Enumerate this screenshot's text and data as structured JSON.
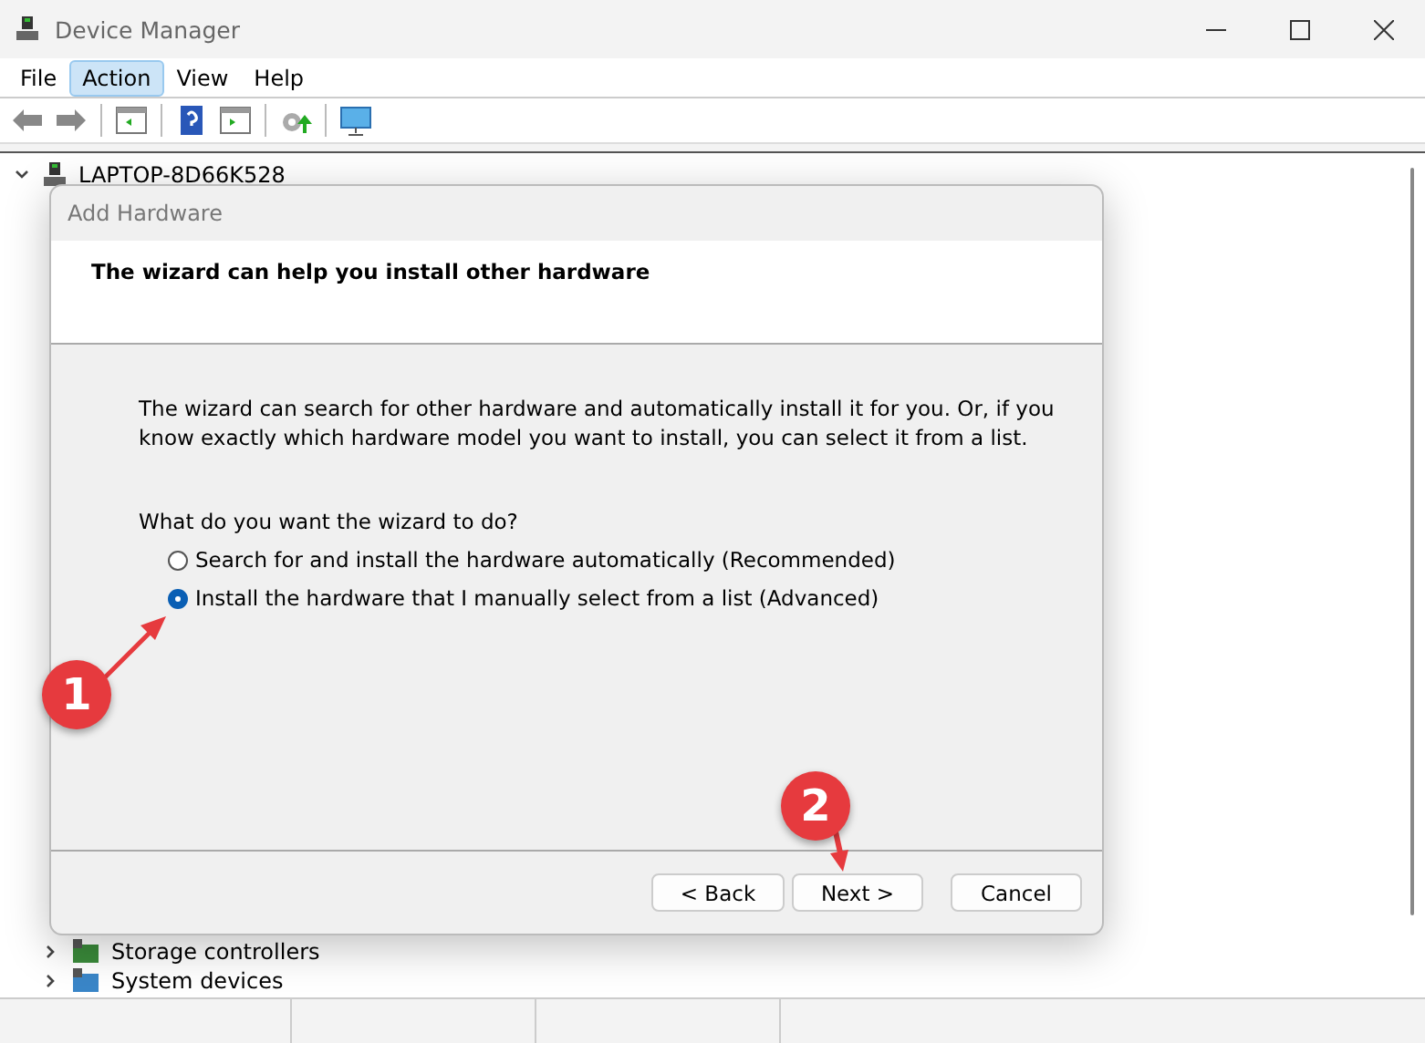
{
  "window": {
    "title": "Device Manager"
  },
  "menu": [
    {
      "label": "File",
      "selected": false
    },
    {
      "label": "Action",
      "selected": true
    },
    {
      "label": "View",
      "selected": false
    },
    {
      "label": "Help",
      "selected": false
    }
  ],
  "tree": {
    "label": "LAPTOP-8D66K528",
    "expanded": true,
    "children": [
      {
        "label": "Storage controllers",
        "expanded": false
      },
      {
        "label": "System devices",
        "expanded": false
      }
    ]
  },
  "dialog": {
    "title": "Add Hardware",
    "heading": "The wizard can help you install other hardware",
    "intro": "The wizard can search for other hardware and automatically install it for you. Or, if you know exactly which hardware model you want to install, you can select it from a list.",
    "question": "What do you want the wizard to do?",
    "options": [
      {
        "label": "Search for and install the hardware automatically (Recommended)",
        "selected": false
      },
      {
        "label": "Install the hardware that I manually select from a list (Advanced)",
        "selected": true
      }
    ],
    "buttons": [
      "< Back",
      "Next >",
      "Cancel"
    ]
  },
  "annotations": [
    {
      "label": "1"
    },
    {
      "label": "2"
    }
  ]
}
